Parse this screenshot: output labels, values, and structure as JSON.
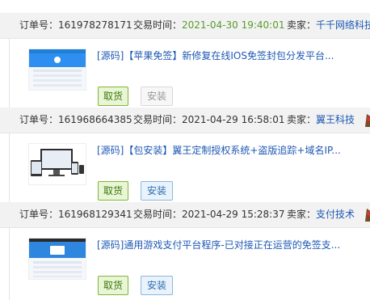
{
  "labels": {
    "order_no": "订单号：",
    "trade_time": "交易时间：",
    "seller": "卖家："
  },
  "colors": {
    "header_bg": "#f2f2f2",
    "link_blue": "#1e58b4",
    "time_green": "#5a9a2a",
    "take_green": "#7bb934",
    "install_blue": "#8ab8df"
  },
  "orders": [
    {
      "order_no": "161978278171",
      "trade_time": "2021-04-30 19:40:01",
      "time_highlight": true,
      "seller": "千千网络科技",
      "title": "[源码]【苹果免签】新修复在线IOS免签封包分发平台...",
      "take_label": "取货",
      "install_label": "安装",
      "install_disabled": true
    },
    {
      "order_no": "161968664385",
      "trade_time": "2021-04-29 16:58:01",
      "time_highlight": false,
      "seller": "翼王科技",
      "title": "[源码]【包安装】翼王定制授权系统+盗版追踪+域名IP...",
      "take_label": "取货",
      "install_label": "安装",
      "install_disabled": false
    },
    {
      "order_no": "161968129341",
      "trade_time": "2021-04-29 15:28:37",
      "time_highlight": false,
      "seller": "支付技术",
      "title": "[源码]通用游戏支付平台程序-已对接正在运营的免签支...",
      "take_label": "取货",
      "install_label": "安装",
      "install_disabled": false
    }
  ]
}
